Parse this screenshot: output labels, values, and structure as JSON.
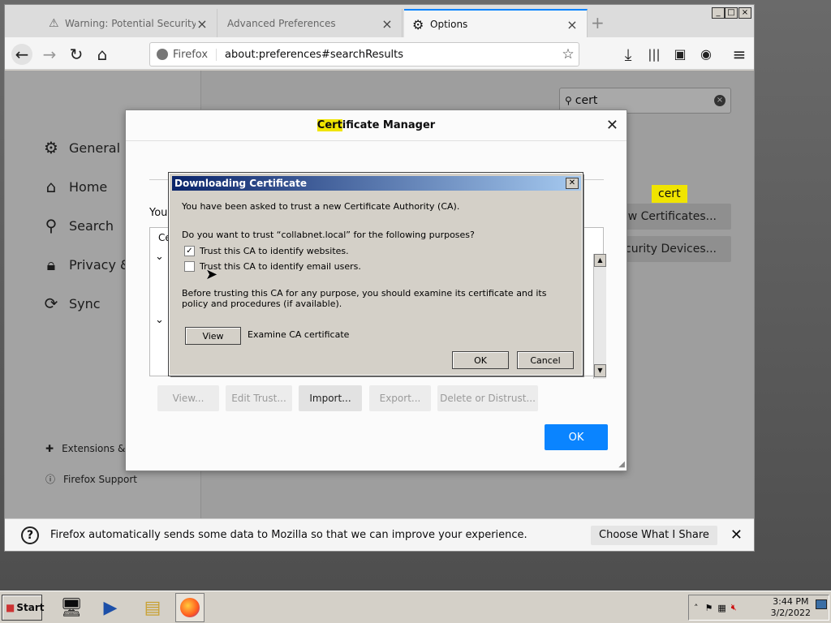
{
  "browser": {
    "tabs": [
      {
        "label": "Warning: Potential Security Risk Ah",
        "active": false
      },
      {
        "label": "Advanced Preferences",
        "active": false
      },
      {
        "label": "Options",
        "active": true
      }
    ],
    "identity_label": "Firefox",
    "url": "about:preferences#searchResults"
  },
  "preferences": {
    "categories": [
      {
        "icon": "gear-icon",
        "label": "General"
      },
      {
        "icon": "home-icon",
        "label": "Home"
      },
      {
        "icon": "search-icon",
        "label": "Search"
      },
      {
        "icon": "lock-icon",
        "label": "Privacy & Security"
      },
      {
        "icon": "sync-icon",
        "label": "Sync"
      }
    ],
    "footer_links": [
      {
        "icon": "puzzle-icon",
        "label": "Extensions & Themes"
      },
      {
        "icon": "help-icon",
        "label": "Firefox Support"
      }
    ],
    "search_value": "cert",
    "search_tooltip": "cert",
    "view_certificates_label": "View Certificates...",
    "security_devices_label": "Security Devices..."
  },
  "cert_manager": {
    "title_highlight": "Cert",
    "title_rest": "ificate Manager",
    "intro_fragment": "You",
    "column_fragment": "Ce",
    "buttons": {
      "view": "View...",
      "edit_trust": "Edit Trust...",
      "import": "Import...",
      "export": "Export...",
      "delete": "Delete or Distrust..."
    },
    "ok_label": "OK"
  },
  "download_dialog": {
    "title": "Downloading Certificate",
    "line1": "You have been asked to trust a new Certificate Authority (CA).",
    "line2": "Do you want to trust “collabnet.local” for the following purposes?",
    "check_websites": "Trust this CA to identify websites.",
    "check_websites_checked": true,
    "check_email": "Trust this CA to identify email users.",
    "check_email_checked": false,
    "para": "Before trusting this CA for any purpose, you should examine its certificate and its policy and procedures (if available).",
    "view_label": "View",
    "examine_label": "Examine CA certificate",
    "ok_label": "OK",
    "cancel_label": "Cancel"
  },
  "notification": {
    "message": "Firefox automatically sends some data to Mozilla so that we can improve your experience.",
    "button": "Choose What I Share"
  },
  "taskbar": {
    "start_label": "Start",
    "time": "3:44 PM",
    "date": "3/2/2022"
  }
}
